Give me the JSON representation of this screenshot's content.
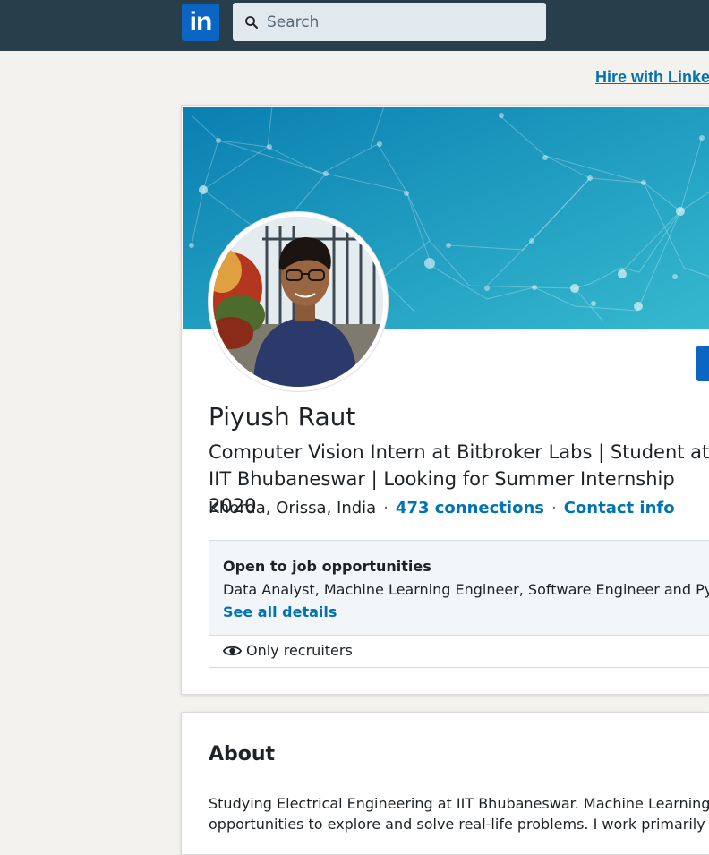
{
  "nav": {
    "logo_text": "in",
    "search_placeholder": "Search"
  },
  "promo": {
    "hire_link": "Hire with Linke"
  },
  "profile": {
    "name": "Piyush Raut",
    "headline": "Computer Vision Intern at Bitbroker Labs | Student at IIT Bhubaneswar | Looking for Summer Internship 2020",
    "location": "Khorda, Orissa, India",
    "separator": "·",
    "connections": "473 connections",
    "contact_info": "Contact info"
  },
  "open_to_work": {
    "title": "Open to job opportunities",
    "roles": "Data Analyst, Machine Learning Engineer, Software Engineer and Pytho",
    "details_link": "See all details",
    "visibility": "Only recruiters"
  },
  "about": {
    "title": "About",
    "line1": "Studying Electrical Engineering at IIT Bhubaneswar. Machine Learning and",
    "line2": "opportunities to explore and solve real-life problems. I work primarily wit"
  },
  "colors": {
    "topbar": "#283e4a",
    "brand_blue": "#0a66c2",
    "link_blue": "#0073b1",
    "banner_start": "#0a7fb1",
    "banner_end": "#36b9cf"
  },
  "icons": {
    "search": "search-icon",
    "eye": "eye-icon"
  }
}
